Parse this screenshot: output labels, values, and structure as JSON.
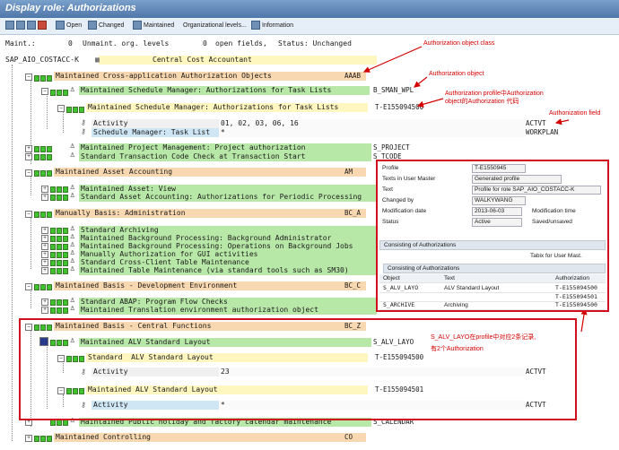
{
  "window": {
    "title": "Display role: Authorizations"
  },
  "toolbar": {
    "items": [
      {
        "label": "Open"
      },
      {
        "label": "Changed"
      },
      {
        "label": "Maintained"
      },
      {
        "label": "Organizational levels..."
      },
      {
        "label": "Information"
      }
    ]
  },
  "status": {
    "maint_label": "Maint.:",
    "unmaint_count": "0",
    "unmaint_label": "Unmaint. org. levels",
    "open_count": "0",
    "open_label": "open fields,",
    "status_text": "Status: Unchanged"
  },
  "root": {
    "name": "SAP_AIO_COSTACC-K",
    "desc": "Central Cost Accountant"
  },
  "tree": {
    "n1": {
      "status": "Maintained",
      "text": "Cross-application Authorization Objects",
      "code": "AAAB"
    },
    "n2": {
      "status": "Maintained",
      "text": "Schedule Manager: Authorizations for Task Lists",
      "code": "B_SMAN_WPL"
    },
    "n3": {
      "status": "Maintained",
      "text": "Schedule Manager: Authorizations for Task Lists",
      "code": "T-E155094500"
    },
    "f1": {
      "field": "Activity",
      "value": "01, 02, 03, 06, 16",
      "code": "ACTVT"
    },
    "f2": {
      "field": "Schedule Manager: Task List",
      "value": "*",
      "code": "WORKPLAN"
    },
    "n4": {
      "status": "Maintained",
      "text": "Project Management: Project authorization",
      "code": "S_PROJECT"
    },
    "n5": {
      "status": "Standard",
      "text": "Transaction Code Check at Transaction Start",
      "code": "S_TCODE"
    },
    "n6": {
      "status": "Maintained",
      "text": "Asset Accounting",
      "code": "AM"
    },
    "n7": {
      "status": "Maintained",
      "text": "Asset: View"
    },
    "n8": {
      "status": "Standard",
      "text": "Asset Accounting: Authorizations for Periodic Processing"
    },
    "n9": {
      "status": "Manually",
      "text": "Basis: Administration",
      "code": "BC_A"
    },
    "n10": {
      "status": "Standard",
      "text": "Archiving"
    },
    "n11": {
      "status": "Maintained",
      "text": "Background Processing: Background Administrator"
    },
    "n12": {
      "status": "Maintained",
      "text": "Background Processing: Operations on Background Jobs"
    },
    "n13": {
      "status": "Manually",
      "text": "Authorization for GUI activities"
    },
    "n14": {
      "status": "Standard",
      "text": "Cross-Client Table Maintenance"
    },
    "n15": {
      "status": "Maintained",
      "text": "Table Maintenance (via standard tools such as SM30)"
    },
    "n16": {
      "status": "Maintained",
      "text": "Basis - Development Environment",
      "code": "BC_C"
    },
    "n17": {
      "status": "Standard",
      "text": "ABAP: Program Flow Checks"
    },
    "n18": {
      "status": "Maintained",
      "text": "Translation environment authorization object"
    },
    "n19": {
      "status": "Maintained",
      "text": "Basis - Central Functions",
      "code": "BC_Z"
    },
    "n20": {
      "status": "Maintained",
      "text": "ALV Standard Layout",
      "code": "S_ALV_LAYO"
    },
    "n21": {
      "status": "Standard",
      "text": "ALV Standard Layout",
      "code": "T-E155094500"
    },
    "f3": {
      "field": "Activity",
      "value": "23",
      "code": "ACTVT"
    },
    "n22": {
      "status": "Maintained",
      "text": "ALV Standard Layout",
      "code": "T-E155094501"
    },
    "f4": {
      "field": "Activity",
      "value": "*",
      "code": "ACTVT"
    },
    "n23": {
      "status": "Maintained",
      "text": "Public holiday and factory calendar maintenance",
      "code": "S_CALENDAR"
    },
    "n24": {
      "status": "Maintained",
      "text": "Controlling",
      "code": "CO"
    }
  },
  "annotations": {
    "a1": "Authorization object class",
    "a2": "Authorization object",
    "a3": "Authorization profile中Authorization",
    "a4": "object的Authorization 代码",
    "a5": "Authonization field",
    "a6": "S_ALV_LAYO在profile中对应2条记录,",
    "a7": "有2个Authorization"
  },
  "popup": {
    "fields": [
      {
        "label": "Profile",
        "value": "T-E1550945"
      },
      {
        "label": "Texts in User Master",
        "value": "Generated profile"
      },
      {
        "label": "Text",
        "value": "Profile for role SAP_AIO_COSTACC-K"
      },
      {
        "label": "Changed by",
        "value": "WALKYWANG"
      },
      {
        "label": "Modification date",
        "value": "2013-06-03",
        "extra": "Modification time"
      },
      {
        "label": "Status",
        "value": "Active",
        "extra": "Saved/unsaved"
      }
    ],
    "section_title": "Consisting of Authorizations",
    "tabix_label": "Tabix for User Mast.",
    "table_title": "Consisting of Authorizations",
    "columns": [
      "Object",
      "Text",
      "Authorization"
    ],
    "rows": [
      [
        "S_ALV_LAYO",
        "ALV Standard Layout",
        "T-E155094500"
      ],
      [
        "",
        "",
        "T-E155094501"
      ],
      [
        "S_ARCHIVE",
        "Archiving",
        "T-E155094500"
      ]
    ]
  }
}
